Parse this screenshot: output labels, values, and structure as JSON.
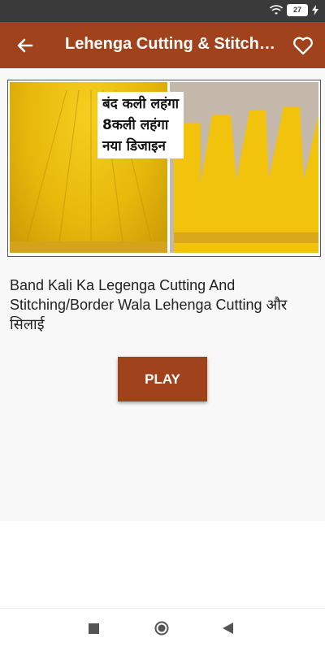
{
  "status_bar": {
    "battery_level": "27"
  },
  "app_bar": {
    "title": "Lehenga Cutting & Stitching",
    "back_icon": "arrow-back-icon",
    "favorite_icon": "heart-outline-icon"
  },
  "video": {
    "thumbnail_text": [
      "बंद कली लहंगा",
      "8कली लहंगा",
      "नया डिजाइन"
    ],
    "title": "Band Kali Ka Legenga Cutting And Stitching/Border Wala Lehenga Cutting और सिलाई",
    "play_label": "PLAY"
  },
  "colors": {
    "primary": "#a0421c",
    "background": "#f8f8f8"
  }
}
